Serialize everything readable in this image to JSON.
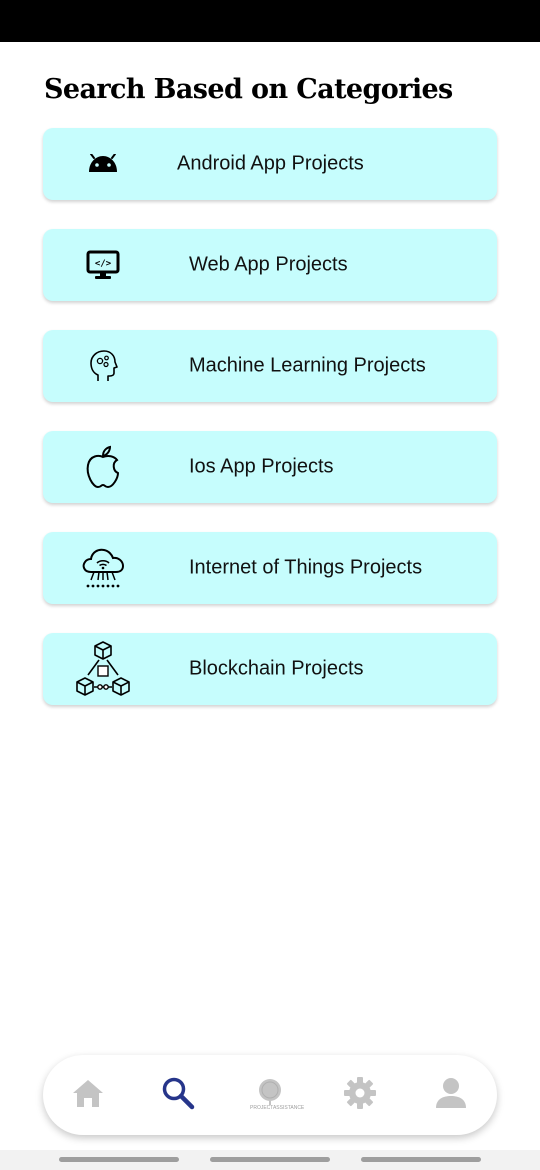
{
  "page": {
    "title": "Search Based on Categories"
  },
  "colors": {
    "card_bg": "#c6fdfd",
    "nav_inactive": "#c4c4c4",
    "nav_active": "#26358a",
    "status_bar": "#000000"
  },
  "categories": [
    {
      "label": "Android App Projects",
      "icon": "android-icon"
    },
    {
      "label": "Web App Projects",
      "icon": "web-code-monitor-icon"
    },
    {
      "label": "Machine Learning Projects",
      "icon": "ai-head-icon"
    },
    {
      "label": "Ios App Projects",
      "icon": "apple-icon"
    },
    {
      "label": "Internet of Things Projects",
      "icon": "iot-cloud-icon"
    },
    {
      "label": "Blockchain Projects",
      "icon": "blockchain-icon"
    }
  ],
  "bottom_nav": {
    "items": [
      {
        "name": "home",
        "icon": "home-icon",
        "active": false
      },
      {
        "name": "search",
        "icon": "search-icon",
        "active": true
      },
      {
        "name": "logo",
        "icon": "app-logo-icon",
        "active": false,
        "logo_text": "PROJECTASSISTANCE"
      },
      {
        "name": "settings",
        "icon": "gear-icon",
        "active": false
      },
      {
        "name": "profile",
        "icon": "person-icon",
        "active": false
      }
    ]
  }
}
